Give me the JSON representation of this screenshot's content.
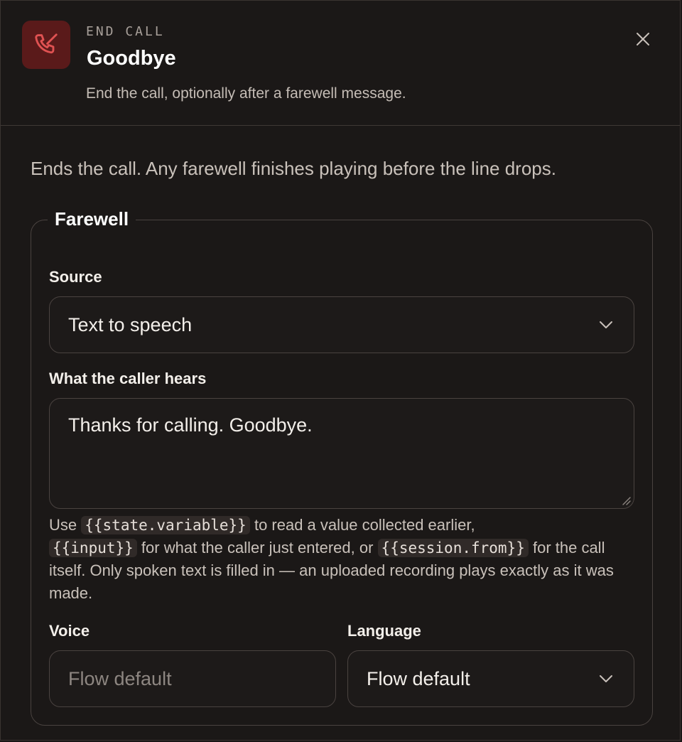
{
  "header": {
    "eyebrow": "END CALL",
    "title": "Goodbye",
    "subtitle": "End the call, optionally after a farewell message.",
    "icon": "phone-hangup-icon",
    "accent_color": "#e05252",
    "close_icon": "close-icon"
  },
  "intro": "Ends the call. Any farewell finishes playing before the line drops.",
  "farewell": {
    "legend": "Farewell",
    "source": {
      "label": "Source",
      "value": "Text to speech"
    },
    "message": {
      "label": "What the caller hears",
      "value": "Thanks for calling. Goodbye."
    },
    "help": {
      "part1": "Use",
      "code1": "{{state.variable}}",
      "part2": "to read a value collected earlier,",
      "code2": "{{input}}",
      "part3": "for what the caller just entered, or",
      "code3": "{{session.from}}",
      "part4": "for the call itself. Only spoken text is filled in — an uploaded recording plays exactly as it was made."
    },
    "voice": {
      "label": "Voice",
      "placeholder": "Flow default"
    },
    "language": {
      "label": "Language",
      "value": "Flow default"
    }
  }
}
